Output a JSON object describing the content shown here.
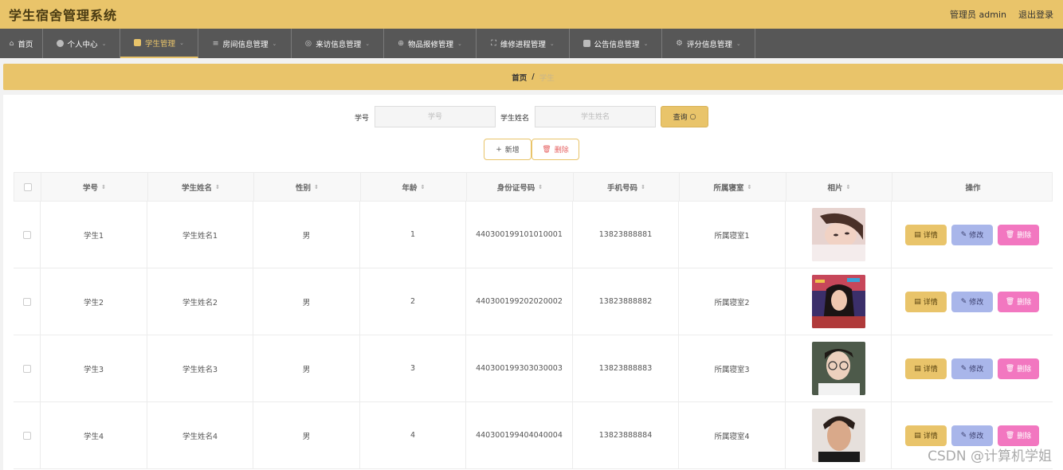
{
  "header": {
    "app_title": "学生宿舍管理系统",
    "user_label": "管理员 admin",
    "logout": "退出登录"
  },
  "nav": [
    {
      "label": "首页",
      "icon": "home-icon"
    },
    {
      "label": "个人中心",
      "icon": "user-icon"
    },
    {
      "label": "学生管理",
      "icon": "student-icon"
    },
    {
      "label": "房间信息管理",
      "icon": "list-icon"
    },
    {
      "label": "来访信息管理",
      "icon": "compass-icon"
    },
    {
      "label": "物品报修管理",
      "icon": "target-icon"
    },
    {
      "label": "维修进程管理",
      "icon": "expand-icon"
    },
    {
      "label": "公告信息管理",
      "icon": "clipboard-icon"
    },
    {
      "label": "评分信息管理",
      "icon": "settings-icon"
    }
  ],
  "breadcrumb": {
    "home": "首页",
    "sep": "/",
    "current": "学生"
  },
  "search": {
    "id_label": "学号",
    "id_placeholder": "学号",
    "name_label": "学生姓名",
    "name_placeholder": "学生姓名",
    "query_button": "查询"
  },
  "actions": {
    "add": "新增",
    "delete": "删除"
  },
  "table": {
    "columns": [
      "学号",
      "学生姓名",
      "性别",
      "年龄",
      "身份证号码",
      "手机号码",
      "所属寝室",
      "相片",
      "操作"
    ],
    "rows": [
      {
        "id": "学生1",
        "name": "学生姓名1",
        "gender": "男",
        "age": "1",
        "idcard": "440300199101010001",
        "phone": "13823888881",
        "room": "所属寝室1"
      },
      {
        "id": "学生2",
        "name": "学生姓名2",
        "gender": "男",
        "age": "2",
        "idcard": "440300199202020002",
        "phone": "13823888882",
        "room": "所属寝室2"
      },
      {
        "id": "学生3",
        "name": "学生姓名3",
        "gender": "男",
        "age": "3",
        "idcard": "440300199303030003",
        "phone": "13823888883",
        "room": "所属寝室3"
      },
      {
        "id": "学生4",
        "name": "学生姓名4",
        "gender": "男",
        "age": "4",
        "idcard": "440300199404040004",
        "phone": "13823888884",
        "room": "所属寝室4"
      }
    ],
    "row_actions": {
      "detail": "详情",
      "edit": "修改",
      "delete": "删除"
    }
  },
  "watermark": "CSDN @计算机学姐",
  "colors": {
    "accent": "#e9c46a",
    "nav_bg": "#575757",
    "edit": "#a9b6ea",
    "delete": "#f277c0"
  }
}
